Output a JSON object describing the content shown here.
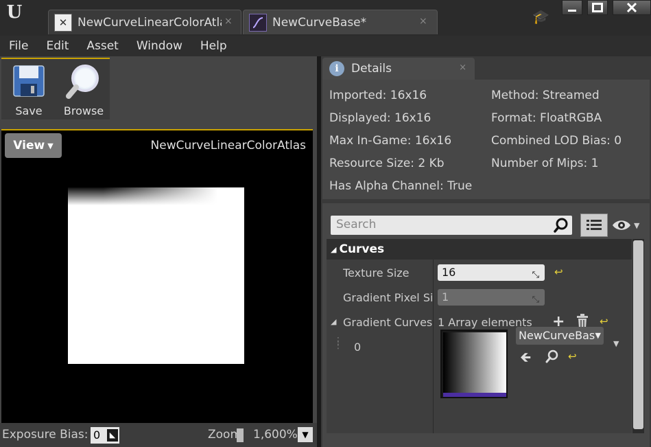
{
  "titlebar": {
    "tabs": [
      {
        "label": "NewCurveLinearColorAtlas"
      },
      {
        "label": "NewCurveBase*"
      }
    ],
    "close_glyph": "×"
  },
  "menu": [
    "File",
    "Edit",
    "Asset",
    "Window",
    "Help"
  ],
  "toolbar": {
    "save_label": "Save",
    "browse_label": "Browse"
  },
  "viewport": {
    "view_label": "View",
    "title": "NewCurveLinearColorAtlas"
  },
  "statusbar": {
    "exposure_label": "Exposure Bias:",
    "exposure_value": "0",
    "zoom_label": "Zoom",
    "zoom_value": "1,600%"
  },
  "details": {
    "tab_title": "Details",
    "info": [
      "Imported: 16x16",
      "Displayed: 16x16",
      "Max In-Game: 16x16",
      "Resource Size: 2 Kb",
      "Has Alpha Channel: True",
      "Method: Streamed",
      "Format: FloatRGBA",
      "Combined LOD Bias: 0",
      "Number of Mips: 1"
    ],
    "search_placeholder": "Search",
    "category": "Curves",
    "props": {
      "texture_size_label": "Texture Size",
      "texture_size_value": "16",
      "gradient_pixel_label": "Gradient Pixel Si",
      "gradient_pixel_value": "1",
      "gradient_curves_label": "Gradient Curves",
      "gradient_curves_count": "1 Array elements",
      "element_index": "0",
      "element_asset": "NewCurveBas"
    }
  },
  "colors": {
    "accent_yellow": "#c9a200",
    "reset_yellow": "#e8d23a",
    "curve_bar": "#4b2ea0"
  }
}
